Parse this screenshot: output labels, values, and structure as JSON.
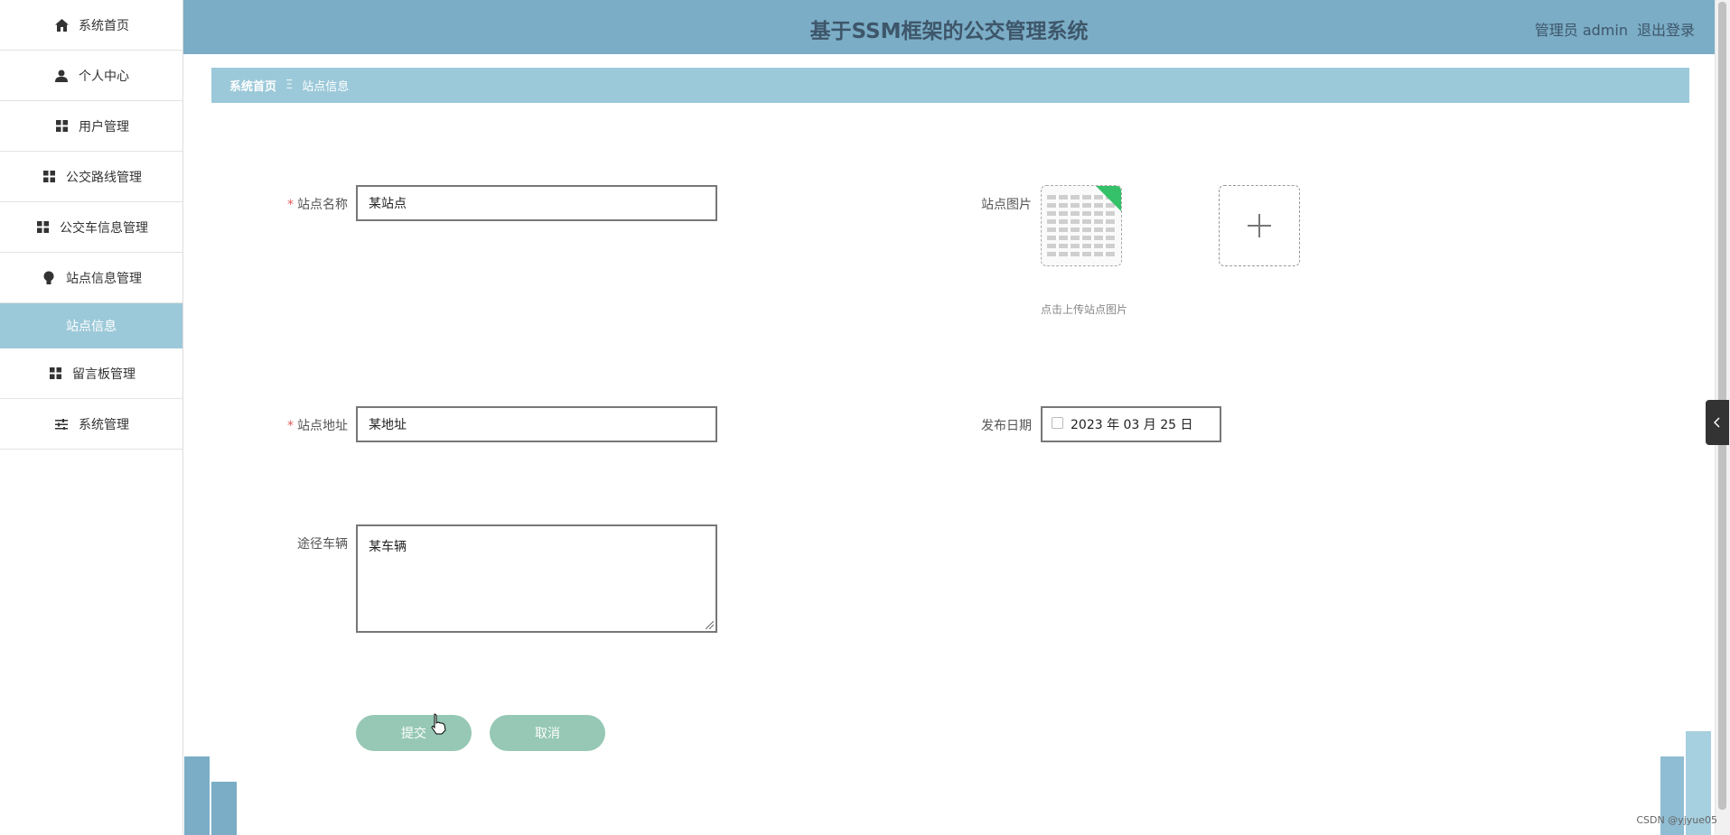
{
  "app": {
    "title": "基于SSM框架的公交管理系统",
    "user_role": "管理员 admin",
    "logout": "退出登录"
  },
  "sidebar": {
    "items": [
      {
        "label": "系统首页",
        "icon": "home-icon"
      },
      {
        "label": "个人中心",
        "icon": "user-icon"
      },
      {
        "label": "用户管理",
        "icon": "grid-icon"
      },
      {
        "label": "公交路线管理",
        "icon": "grid-icon"
      },
      {
        "label": "公交车信息管理",
        "icon": "grid-icon"
      },
      {
        "label": "站点信息管理",
        "icon": "bulb-icon"
      },
      {
        "label": "站点信息",
        "icon": ""
      },
      {
        "label": "留言板管理",
        "icon": "grid-icon"
      },
      {
        "label": "系统管理",
        "icon": "sliders-icon"
      }
    ],
    "active_index": 6
  },
  "breadcrumb": {
    "home": "系统首页",
    "separator": "Ξ",
    "current": "站点信息"
  },
  "form": {
    "station_name": {
      "label": "站点名称",
      "value": "某站点",
      "required": true
    },
    "station_image": {
      "label": "站点图片",
      "hint": "点击上传站点图片"
    },
    "station_address": {
      "label": "站点地址",
      "value": "某地址",
      "required": true
    },
    "publish_date": {
      "label": "发布日期",
      "value": "2023 年 03 月 25 日"
    },
    "vehicles": {
      "label": "途径车辆",
      "value": "某车辆"
    },
    "required_mark": "*",
    "submit": "提交",
    "cancel": "取消"
  },
  "watermark": "CSDN @yjyue05",
  "colors": {
    "header_bg": "#7badc6",
    "breadcrumb_bg": "#9cc9d9",
    "active_item_bg": "#9cc9d9",
    "button_bg": "#96c8b5",
    "required": "#e25c5c"
  }
}
